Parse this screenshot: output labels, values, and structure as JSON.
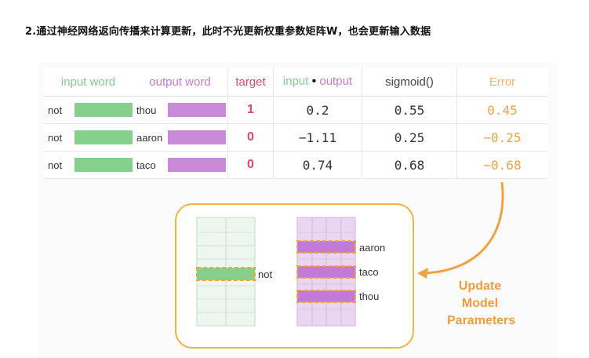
{
  "heading": "2.通过神经网络返向传播来计算更新，此时不光更新权重参数矩阵W，也会更新输入数据",
  "table": {
    "headers": {
      "input_word": "input word",
      "output_word": "output word",
      "target": "target",
      "dot_input": "input",
      "dot_output": "output",
      "sigmoid": "sigmoid()",
      "error": "Error"
    },
    "rows": [
      {
        "input": "not",
        "output": "thou",
        "target": "1",
        "dot": "0.2",
        "sigmoid": "0.55",
        "error": "0.45"
      },
      {
        "input": "not",
        "output": "aaron",
        "target": "0",
        "dot": "−1.11",
        "sigmoid": "0.25",
        "error": "−0.25"
      },
      {
        "input": "not",
        "output": "taco",
        "target": "0",
        "dot": "0.74",
        "sigmoid": "0.68",
        "error": "−0.68"
      }
    ]
  },
  "model": {
    "embedding_label": "not",
    "context_labels": [
      "aaron",
      "taco",
      "thou"
    ]
  },
  "update": {
    "line1": "Update",
    "line2": "Model",
    "line3": "Parameters"
  },
  "colors": {
    "input_green": "#86d08d",
    "output_purple": "#c98ad9",
    "target_red": "#d94a6a",
    "error_orange": "#f1a240",
    "update_orange": "#f19d3b",
    "box_border": "#f1b341"
  }
}
